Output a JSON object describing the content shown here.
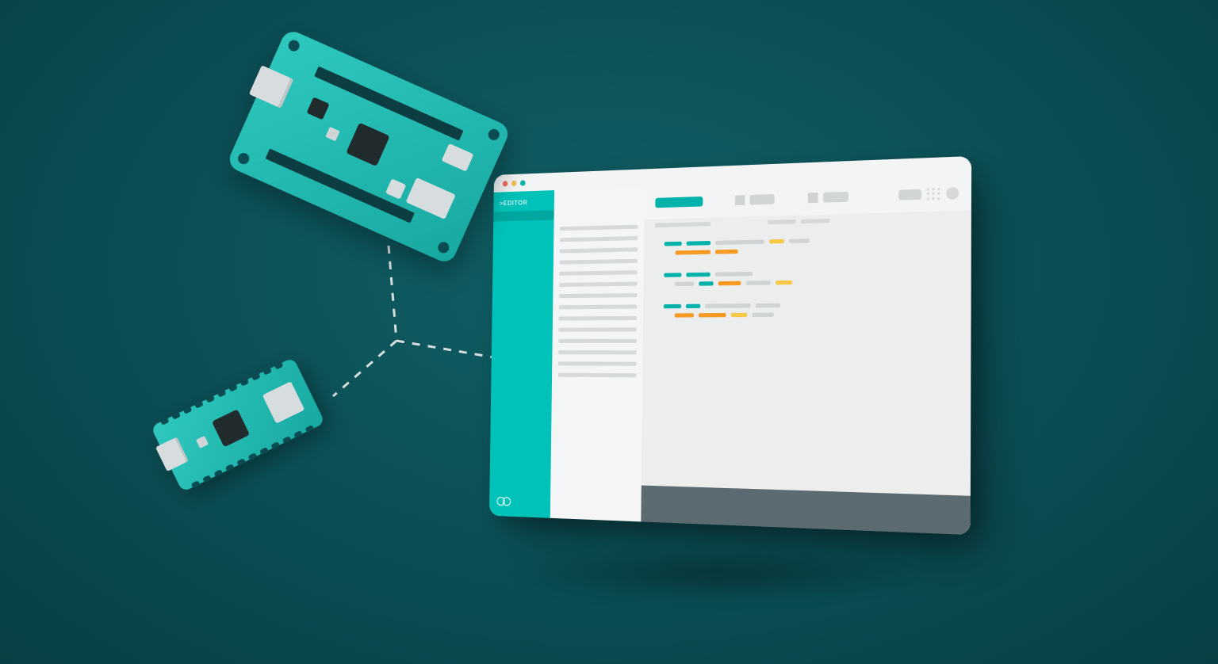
{
  "editor": {
    "sidebar_label": ">EDITOR",
    "traffic_light_colors": {
      "close": "#ed6a5e",
      "min": "#f5bf4f",
      "max": "#00b2a9"
    },
    "logo": "arduino-infinity-icon"
  },
  "colors": {
    "background": "#0a4c52",
    "teal": "#00c2b8",
    "teal_dark": "#00a79e",
    "white": "#e9ebec",
    "console": "#5c6a71",
    "orange": "#f59b23",
    "yellow": "#f7c948"
  },
  "boards": {
    "large": "arduino-mkr-board",
    "small": "arduino-nano-board"
  }
}
